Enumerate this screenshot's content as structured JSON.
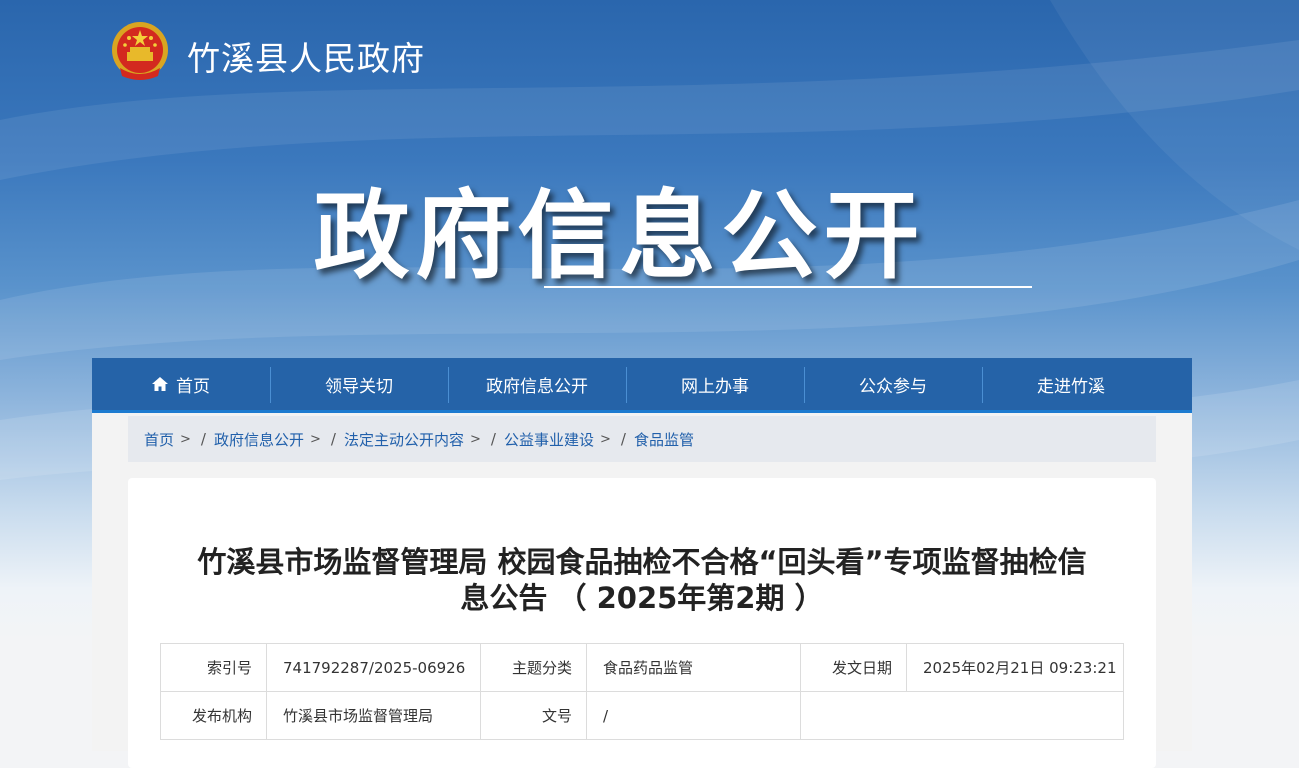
{
  "site": {
    "name": "竹溪县人民政府"
  },
  "hero": {
    "title": "政府信息公开"
  },
  "nav": {
    "items": [
      {
        "label": "首页",
        "icon": "home-icon"
      },
      {
        "label": "领导关切"
      },
      {
        "label": "政府信息公开"
      },
      {
        "label": "网上办事"
      },
      {
        "label": "公众参与"
      },
      {
        "label": "走进竹溪"
      }
    ]
  },
  "breadcrumb": {
    "items": [
      "首页",
      "政府信息公开",
      "法定主动公开内容",
      "公益事业建设",
      "食品监管"
    ],
    "separator": ">"
  },
  "article": {
    "title_line1": "竹溪县市场监督管理局 校园食品抽检不合格“回头看”专项监督抽检信",
    "title_line2": "息公告 （ 2025年第2期 ）",
    "meta": {
      "index_label": "索引号",
      "index_value": "741792287/2025-06926",
      "topic_label": "主题分类",
      "topic_value": "食品药品监管",
      "date_label": "发文日期",
      "date_value": "2025年02月21日 09:23:21",
      "publisher_label": "发布机构",
      "publisher_value": "竹溪县市场监督管理局",
      "docno_label": "文号",
      "docno_value": "/"
    }
  },
  "colors": {
    "nav_bg": "#2563a8",
    "link": "#2160ab",
    "banner_top": "#2a66ad"
  }
}
